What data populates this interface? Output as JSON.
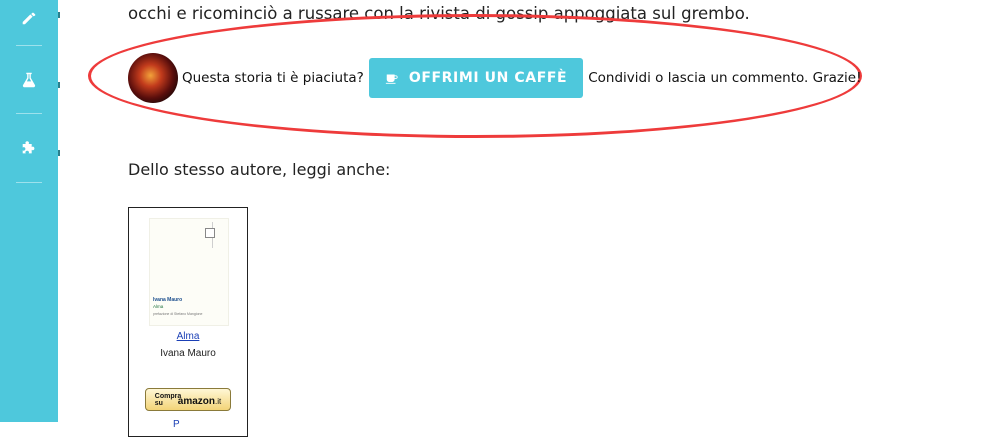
{
  "sidebar": {
    "accent": "#4ec8dc",
    "items": [
      {
        "name": "pencil-icon"
      },
      {
        "name": "flask-icon"
      },
      {
        "name": "puzzle-icon"
      }
    ]
  },
  "story": {
    "last_line": "occhi e ricominciò a russare con la rivista di gossip appoggiata sul grembo."
  },
  "cta": {
    "question": "Questa storia ti è piaciuta?",
    "button_label": "OFFRIMI UN CAFFÈ",
    "button_icon": "coffee-cup-icon",
    "button_color": "#4ec8dc",
    "closing": "Condividi o lascia un commento. Grazie!",
    "highlight_color": "#ee3b3b"
  },
  "related": {
    "heading": "Dello stesso autore, leggi anche:",
    "books": [
      {
        "title": "Alma",
        "author": "Ivana Mauro",
        "cover_author": "Ivana Mauro",
        "cover_title": "Alma",
        "cover_subtitle": "prefazione di Stefano Mangione",
        "buy_small": "Compra su",
        "buy_brand": "amazon",
        "buy_domain": ".it"
      }
    ]
  }
}
